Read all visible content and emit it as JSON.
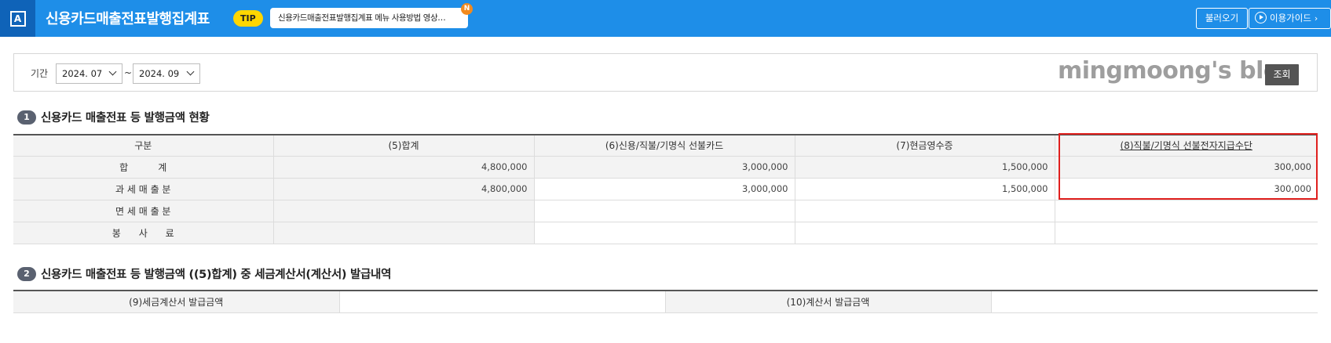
{
  "header": {
    "app_icon_letter": "A",
    "title": "신용카드매출전표발행집계표",
    "tip_badge": "TIP",
    "tip_message": "신용카드매출전표발행집계표 메뉴 사용방법 영상…",
    "tip_new_badge": "N",
    "load_button": "불러오기",
    "guide_button": "이용가이드",
    "guide_chevron": "›"
  },
  "search": {
    "period_label": "기간",
    "from_value": "2024. 07",
    "separator": "~",
    "to_value": "2024. 09",
    "watermark": "mingmoong's blog",
    "query_button": "조회"
  },
  "section1": {
    "number": "1",
    "title": "신용카드 매출전표 등 발행금액 현황",
    "columns": [
      "구분",
      "(5)합계",
      "(6)신용/직불/기명식 선불카드",
      "(7)현금영수증",
      "(8)직불/기명식 선불전자지급수단"
    ],
    "rows": [
      {
        "label": "합          계",
        "values": [
          "4,800,000",
          "3,000,000",
          "1,500,000",
          "300,000"
        ]
      },
      {
        "label": "과 세 매 출 분",
        "values": [
          "4,800,000",
          "3,000,000",
          "1,500,000",
          "300,000"
        ]
      },
      {
        "label": "면 세 매 출 분",
        "values": [
          "",
          "",
          "",
          ""
        ]
      },
      {
        "label": "봉      사      료",
        "values": [
          "",
          "",
          "",
          ""
        ]
      }
    ]
  },
  "section2": {
    "number": "2",
    "title": "신용카드 매출전표 등 발행금액 ((5)합계) 중 세금계산서(계산서) 발급내역",
    "tax_invoice_label": "(9)세금계산서 발급금액",
    "tax_invoice_value": "",
    "invoice_label": "(10)계산서 발급금액",
    "invoice_value": ""
  },
  "colors": {
    "header_bg": "#1e8ee8",
    "logo_bg": "#0f63b8",
    "tip_badge": "#ffd600",
    "new_badge": "#f28a1e",
    "highlight_border": "#e0201e",
    "query_button_bg": "#545454"
  },
  "icons": {
    "app": "app-logo-icon",
    "guide": "play-circle-icon",
    "select_caret": "chevron-down-icon"
  }
}
